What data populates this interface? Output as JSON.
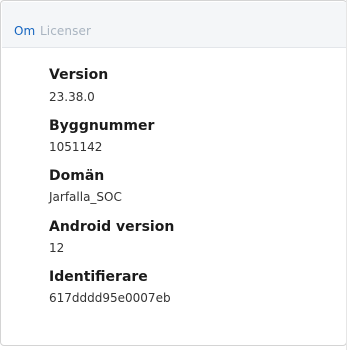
{
  "tabs": {
    "about": "Om",
    "licenses": "Licenser"
  },
  "info": [
    {
      "label": "Version",
      "value": "23.38.0"
    },
    {
      "label": "Byggnummer",
      "value": "1051142"
    },
    {
      "label": "Domän",
      "value": "Jarfalla_SOC"
    },
    {
      "label": "Android version",
      "value": "12"
    },
    {
      "label": "Identifierare",
      "value": "617dddd95e0007eb"
    }
  ],
  "colors": {
    "accent": "#1565c0",
    "inactive_tab": "#a9b4c0",
    "tab_bar_bg": "#f4f6f8"
  }
}
